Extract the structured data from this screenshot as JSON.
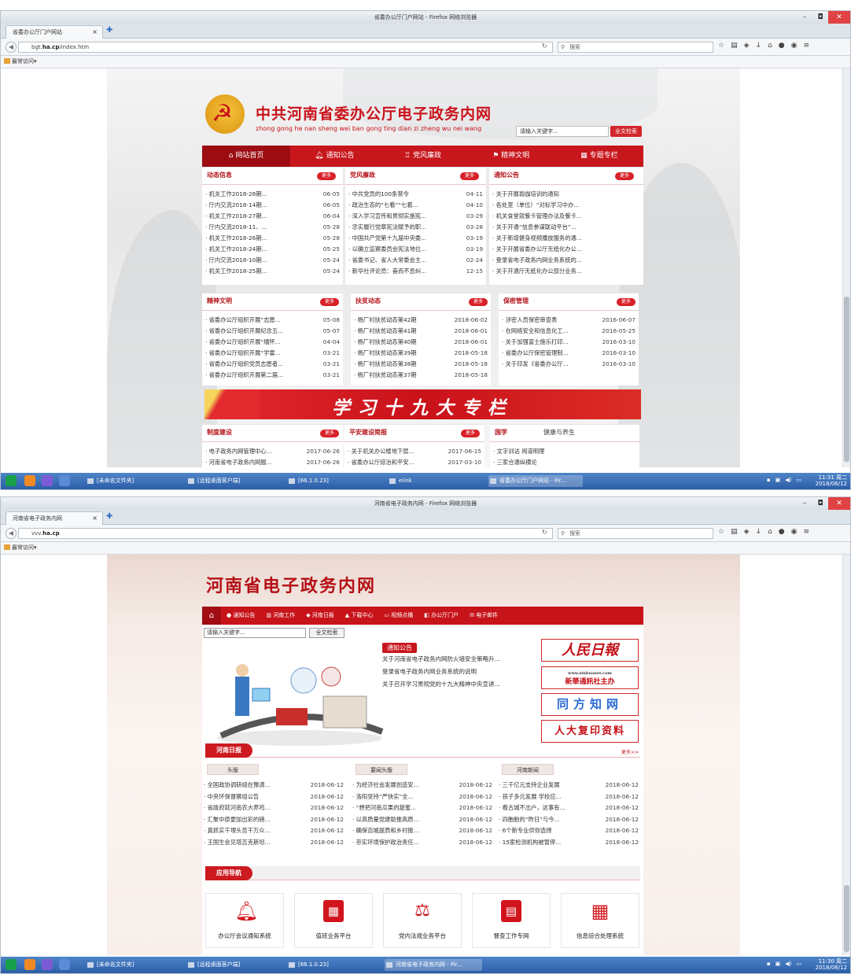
{
  "window1": {
    "title": "省委办公厅门户网站 - Firefox 网络浏览器",
    "tab": "省委办公厅门户网站",
    "url_prefix": "bgt.",
    "url_domain": "ha.cp",
    "url_path": "/index.htm",
    "search_placeholder": "搜索",
    "bookmarks": "最常访问▾"
  },
  "site1": {
    "title": "中共河南省委办公厅电子政务内网",
    "subtitle": "zhong gong he nan sheng wei ban gong ting dian zi zheng wu nei wang",
    "search_placeholder": "请输入关键字...",
    "search_button": "全文检索",
    "nav": [
      "网站首页",
      "通知公告",
      "党风廉政",
      "精神文明",
      "专题专栏"
    ],
    "more": "更多",
    "dongtai": {
      "title": "动态信息",
      "items": [
        {
          "t": "机关工作2018-28期...",
          "d": "06-05"
        },
        {
          "t": "厅内交流2018-14期...",
          "d": "06-05"
        },
        {
          "t": "机关工作2018-27期...",
          "d": "06-04"
        },
        {
          "t": "厅内交流2018-11、...",
          "d": "05-28"
        },
        {
          "t": "机关工作2018-26期...",
          "d": "05-28"
        },
        {
          "t": "机关工作2018-24期...",
          "d": "05-25"
        },
        {
          "t": "厅内交流2018-10期...",
          "d": "05-24"
        },
        {
          "t": "机关工作2018-25期...",
          "d": "05-24"
        }
      ]
    },
    "dangfeng": {
      "title": "党风廉政",
      "items": [
        {
          "t": "中共党员的100条禁令",
          "d": "04-11"
        },
        {
          "t": "政治生态的“七看”“七着...",
          "d": "04-10"
        },
        {
          "t": "深入学习宣传和贯彻实施宪...",
          "d": "03-29"
        },
        {
          "t": "忠实履行党章宪法赋予的职...",
          "d": "03-28"
        },
        {
          "t": "中国共产党第十九届中央委...",
          "d": "03-19"
        },
        {
          "t": "以确立监察委员会宪法地位...",
          "d": "03-19"
        },
        {
          "t": "省委书记、省人大常委会主...",
          "d": "02-24"
        },
        {
          "t": "新华社评论员：奋而不息纠...",
          "d": "12-15"
        }
      ]
    },
    "tongzhi": {
      "title": "通知公告",
      "items": [
        {
          "t": "关于开展瑜伽培训的通知",
          "d": ""
        },
        {
          "t": "各处室（单位）“对标学习中办...",
          "d": ""
        },
        {
          "t": "机关食堂就餐卡管理办法及餐卡...",
          "d": ""
        },
        {
          "t": "关于开通“信息参谋联动平台”...",
          "d": ""
        },
        {
          "t": "关于新增健身视频播放服务的通...",
          "d": ""
        },
        {
          "t": "关于开展省委办公厅无纸化办公...",
          "d": ""
        },
        {
          "t": "登录省电子政务内网业务系统的...",
          "d": ""
        },
        {
          "t": "关于开通厅无纸化办公部分业务...",
          "d": ""
        }
      ]
    },
    "jingshen": {
      "title": "精神文明",
      "items": [
        {
          "t": "省委办公厅组织开展“志愿...",
          "d": "05-08"
        },
        {
          "t": "省委办公厅组织开展纪念五...",
          "d": "05-07"
        },
        {
          "t": "省委办公厅组织开展“缅怀...",
          "d": "04-04"
        },
        {
          "t": "省委办公厅组织开展“学雷...",
          "d": "03-21"
        },
        {
          "t": "省委办公厅组织党员志愿者...",
          "d": "03-21"
        },
        {
          "t": "省委办公厅组织开展第二届...",
          "d": "03-21"
        }
      ]
    },
    "fupin": {
      "title": "扶贫动态",
      "items": [
        {
          "t": "杨厂村扶贫动态第42期",
          "d": "2018-06-02"
        },
        {
          "t": "杨厂村扶贫动态第41期",
          "d": "2018-06-01"
        },
        {
          "t": "杨厂村扶贫动态第40期",
          "d": "2018-06-01"
        },
        {
          "t": "杨厂村扶贫动态第39期",
          "d": "2018-05-18"
        },
        {
          "t": "杨厂村扶贫动态第38期",
          "d": "2018-05-18"
        },
        {
          "t": "杨厂村扶贫动态第37期",
          "d": "2018-05-18"
        }
      ]
    },
    "baomi": {
      "title": "保密管理",
      "items": [
        {
          "t": "涉密人员保密审查表",
          "d": "2016-06-07"
        },
        {
          "t": "在网络安全和信息化工...",
          "d": "2016-05-25"
        },
        {
          "t": "关于加强富士施乐打印...",
          "d": "2016-03-10"
        },
        {
          "t": "省委办公厅保密管理制...",
          "d": "2016-03-10"
        },
        {
          "t": "关于印发《省委办公厅...",
          "d": "2016-03-10"
        }
      ]
    },
    "banner": "学习十九大专栏",
    "zhidu": {
      "title": "制度建设",
      "items": [
        {
          "t": "电子政务内网管理中心...",
          "d": "2017-06-26"
        },
        {
          "t": "河南省电子政务内网服...",
          "d": "2017-06-26"
        }
      ]
    },
    "pingan": {
      "title": "平安建设简报",
      "items": [
        {
          "t": "关于机关办公楼地下层...",
          "d": "2017-06-15"
        },
        {
          "t": "省委办公厅综治和平安...",
          "d": "2017-03-10"
        }
      ]
    },
    "guoxue": {
      "title": "国学",
      "tab2": "健康与养生",
      "items": [
        {
          "t": "文字训诂 阅道明理",
          "d": ""
        },
        {
          "t": "三家合通纵横论",
          "d": ""
        }
      ]
    }
  },
  "window2": {
    "title": "河南省电子政务内网 - Firefox 网络浏览器",
    "tab": "河南省电子政务内网",
    "url_prefix": "vvv.",
    "url_domain": "ha.cp",
    "url_path": "",
    "search_placeholder": "搜索",
    "bookmarks": "最常访问▾"
  },
  "site2": {
    "title": "河南省电子政务内网",
    "nav": [
      "通知公告",
      "河南工作",
      "河南日报",
      "下载中心",
      "视频点播",
      "办公厅门户",
      "电子邮件"
    ],
    "search_placeholder": "请输入关键字...",
    "search_button": "全文检索",
    "notice_tag": "通知公告",
    "notices": [
      "关于河南省电子政务内网防火墙安全策略升...",
      "登录省电子政务内网业务系统的说明",
      "关于召开学习贯彻党的十九大精神中央宣讲..."
    ],
    "media": [
      "人民日報",
      "新華通訊社主办",
      "同方知网",
      "人大复印资料"
    ],
    "media_sub": "www.xinhuanet.com",
    "daily": {
      "tag": "河南日报",
      "more": "更多>>",
      "cols": [
        {
          "head": "头版",
          "items": [
            {
              "t": "全国政协调研组在豫调...",
              "d": "2018-06-12"
            },
            {
              "t": "中央环保督察组公告",
              "d": "2018-06-12"
            },
            {
              "t": "省政府就河南农大养鸡...",
              "d": "2018-06-12"
            },
            {
              "t": "汇聚中原更加出彩的磅...",
              "d": "2018-06-12"
            },
            {
              "t": "真抓实干埋头苦干万众...",
              "d": "2018-06-12"
            },
            {
              "t": "王国生会见塔吉克斯坦...",
              "d": "2018-06-12"
            }
          ]
        },
        {
          "head": "要闻头版",
          "items": [
            {
              "t": "为经济社会发展创造安...",
              "d": "2018-06-12"
            },
            {
              "t": "洛阳坚持“严快实”全...",
              "d": "2018-06-12"
            },
            {
              "t": "“想把河南瓜果的甜蜜...",
              "d": "2018-06-12"
            },
            {
              "t": "以高质量党建助推高质...",
              "d": "2018-06-12"
            },
            {
              "t": "确保百城提质和乡村振...",
              "d": "2018-06-12"
            },
            {
              "t": "夯实环境保护政治责任...",
              "d": "2018-06-12"
            }
          ]
        },
        {
          "head": "河南新闻",
          "items": [
            {
              "t": "三千亿元支持企业发展",
              "d": "2018-06-12"
            },
            {
              "t": "孩子多元发展 学校应...",
              "d": "2018-06-12"
            },
            {
              "t": "看古城不出户，这事有...",
              "d": "2018-06-12"
            },
            {
              "t": "四胞胎的“昨日”与今...",
              "d": "2018-06-12"
            },
            {
              "t": "6个新专业供你选择",
              "d": "2018-06-12"
            },
            {
              "t": "15家检测机构被暂停...",
              "d": "2018-06-12"
            }
          ]
        }
      ]
    },
    "apps_tag": "应用导航",
    "apps": [
      "办公厅会议通知系统",
      "值班业务平台",
      "党内法规业务平台",
      "督查工作专网",
      "信息综合处理系统"
    ]
  },
  "taskbar1": {
    "items": [
      "[未命名文件夹]",
      "[远程桌面客户端]",
      "[66.1.0.23]",
      "elink",
      "省委办公厅门户网站 - Fir..."
    ],
    "time": "11:31 周二",
    "date": "2018/06/12"
  },
  "taskbar2": {
    "items": [
      "[未命名文件夹]",
      "[远程桌面客户端]",
      "[66.1.0.23]",
      "河南省电子政务内网 - Fir..."
    ],
    "time": "11:30 周二",
    "date": "2018/06/12"
  },
  "colors": {
    "brand_red": "#c8161d",
    "taskbar_blue": "#2b5da8",
    "gold": "#f6c23b"
  },
  "icons": [
    "back-icon",
    "reload-icon",
    "search-icon",
    "bookmark-star-icon",
    "download-icon",
    "home-icon",
    "hammer-sickle-logo",
    "bell-icon",
    "calendar-icon",
    "gavel-icon",
    "document-icon",
    "grid-icon"
  ]
}
